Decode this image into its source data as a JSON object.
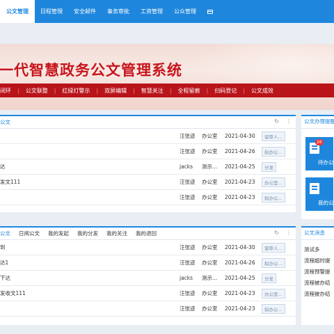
{
  "nav": {
    "tabs": [
      "公文管理",
      "日程管理",
      "安全邮件",
      "事务审批",
      "工资管理",
      "公众管理"
    ],
    "active_index": 0
  },
  "banner": {
    "title": "一代智慧政务公文管理系统",
    "menu": [
      "闭环",
      "公文联整",
      "红绿灯警示",
      "双屏编辑",
      "智慧关注",
      "全程留痕",
      "扫码登记",
      "公文成效"
    ]
  },
  "panel1": {
    "title": "公文",
    "rows": [
      {
        "title": "",
        "sender": "汪张迹",
        "dept": "办公室",
        "date": "2021-04-30",
        "badge": "留审人..."
      },
      {
        "title": "",
        "sender": "汪张迹",
        "dept": "办公室",
        "date": "2021-04-26",
        "badge": "拟办公..."
      },
      {
        "title": "达",
        "sender": "jacks",
        "dept": "测示...",
        "date": "2021-04-25",
        "badge": "分发"
      },
      {
        "title": "发文111",
        "sender": "汪张迹",
        "dept": "办公室",
        "date": "2021-04-23",
        "badge": "办公室..."
      },
      {
        "title": "",
        "sender": "汪张迹",
        "dept": "办公室",
        "date": "2021-04-23",
        "badge": "拟办公..."
      }
    ]
  },
  "panel2": {
    "tabs": [
      "公文",
      "日阅公文",
      "我的发起",
      "我的分发",
      "我的关注",
      "我的退回"
    ],
    "active_index": 0,
    "rows": [
      {
        "title": "到",
        "sender": "汪张迹",
        "dept": "办公室",
        "date": "2021-04-30",
        "badge": "留审人..."
      },
      {
        "title": "达1",
        "sender": "汪张迹",
        "dept": "办公室",
        "date": "2021-04-26",
        "badge": "拟办公..."
      },
      {
        "title": "下达",
        "sender": "jacks",
        "dept": "测示...",
        "date": "2021-04-25",
        "badge": "分发"
      },
      {
        "title": "发收文111",
        "sender": "汪张迹",
        "dept": "办公室",
        "date": "2021-04-23",
        "badge": "办公室..."
      },
      {
        "title": "",
        "sender": "汪张迹",
        "dept": "办公室",
        "date": "2021-04-23",
        "badge": "拟办公..."
      }
    ]
  },
  "right_top": {
    "title": "公文办理提醒",
    "tiles": [
      {
        "label": "待办公",
        "count": "26"
      },
      {
        "label": "我的公",
        "count": ""
      }
    ]
  },
  "right_bottom": {
    "title": "公文消息",
    "items": [
      "测试多",
      "流程超时提",
      "流程预警提",
      "流程被办结",
      "流程被办结"
    ]
  },
  "colors": {
    "nav": "#1e87dd",
    "banner_menu": "#b8141a",
    "banner_title": "#c8141c"
  }
}
